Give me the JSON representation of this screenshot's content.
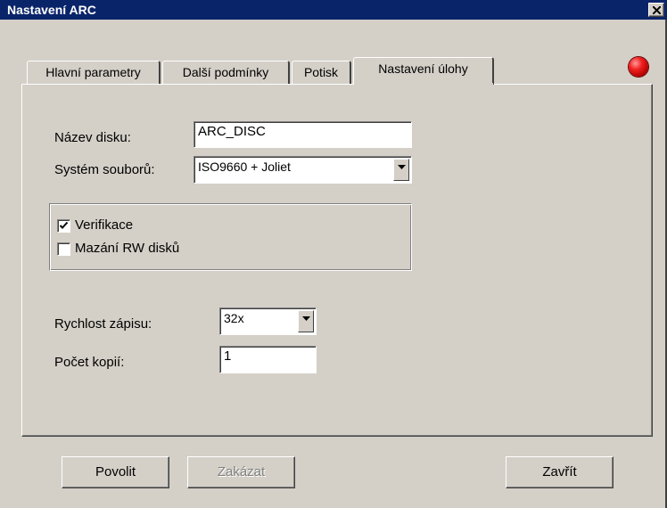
{
  "window": {
    "title": "Nastavení ARC",
    "close_icon": "close-icon"
  },
  "tabs": [
    {
      "label": "Hlavní parametry",
      "active": false
    },
    {
      "label": "Další podmínky",
      "active": false
    },
    {
      "label": "Potisk",
      "active": false
    },
    {
      "label": "Nastavení úlohy",
      "active": true
    }
  ],
  "status_led": {
    "icon": "red-led-icon",
    "color": "#e00000"
  },
  "form": {
    "disc_name_label": "Název disku:",
    "disc_name_value": "ARC_DISC",
    "filesystem_label": "Systém souborů:",
    "filesystem_value": "ISO9660 + Joliet",
    "verify_label": "Verifikace",
    "verify_checked": true,
    "erase_label": "Mazání RW disků",
    "erase_checked": false,
    "speed_label": "Rychlost zápisu:",
    "speed_value": "32x",
    "copies_label": "Počet kopií:",
    "copies_value": "1"
  },
  "buttons": {
    "enable": "Povolit",
    "disable": "Zakázat",
    "close": "Zavřít"
  },
  "colors": {
    "titlebar": "#0a246a",
    "face": "#d4d0c8"
  }
}
